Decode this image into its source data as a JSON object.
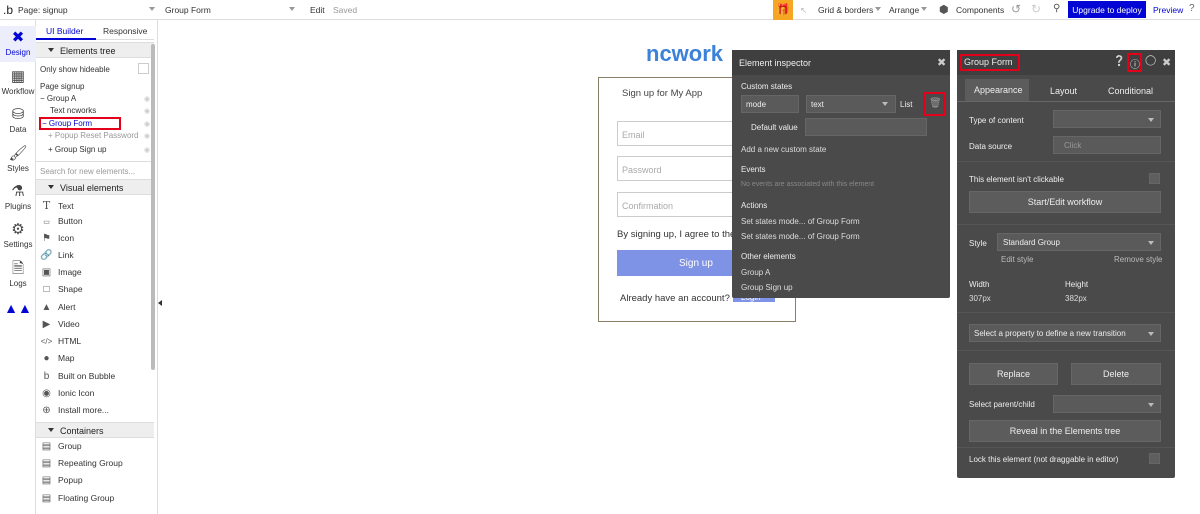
{
  "topbar": {
    "page_label": "Page: signup",
    "element_select": "Group Form",
    "edit": "Edit",
    "saved": "Saved",
    "grid": "Grid & borders",
    "arrange": "Arrange",
    "components": "Components",
    "upgrade": "Upgrade to deploy",
    "preview": "Preview"
  },
  "rail": [
    "Design",
    "Workflow",
    "Data",
    "Styles",
    "Plugins",
    "Settings",
    "Logs"
  ],
  "lpanel": {
    "tab_builder": "UI Builder",
    "tab_responsive": "Responsive",
    "elements_tree": "Elements tree",
    "only_hideable": "Only show hideable",
    "tree": [
      "Page signup",
      "Group A",
      "Text ncworks",
      "Group Form",
      "Popup Reset Password",
      "Group Sign up"
    ],
    "search_placeholder": "Search for new elements...",
    "visual_elements": "Visual elements",
    "visual_items": [
      "Text",
      "Button",
      "Icon",
      "Link",
      "Image",
      "Shape",
      "Alert",
      "Video",
      "HTML",
      "Map",
      "Built on Bubble",
      "Ionic Icon",
      "Install more..."
    ],
    "containers": "Containers",
    "container_items": [
      "Group",
      "Repeating Group",
      "Popup",
      "Floating Group"
    ]
  },
  "canvas": {
    "title": "ncwork",
    "signup_title": "Sign up for My App",
    "email": "Email",
    "password": "Password",
    "confirmation": "Confirmation",
    "agree": "By signing up, I agree to the",
    "signup_btn": "Sign up",
    "already": "Already have an account?",
    "login": "Login"
  },
  "inspector": {
    "title": "Element inspector",
    "custom_states": "Custom states",
    "state_name": "mode",
    "state_type": "text",
    "list": "List",
    "default_value": "Default value",
    "add_state": "Add a new custom state",
    "events": "Events",
    "no_events": "No events are associated with this element",
    "actions": "Actions",
    "action1": "Set states mode... of Group Form",
    "action2": "Set states mode... of Group Form",
    "other": "Other elements",
    "other1": "Group A",
    "other2": "Group Sign up"
  },
  "props": {
    "title": "Group Form",
    "tabs": [
      "Appearance",
      "Layout",
      "Conditional"
    ],
    "type_of_content": "Type of content",
    "data_source": "Data source",
    "click": "Click",
    "not_clickable": "This element isn't clickable",
    "workflow_btn": "Start/Edit workflow",
    "style": "Style",
    "style_value": "Standard Group",
    "edit_style": "Edit style",
    "remove_style": "Remove style",
    "width_label": "Width",
    "width_value": "307px",
    "height_label": "Height",
    "height_value": "382px",
    "transition": "Select a property to define a new transition",
    "replace": "Replace",
    "delete": "Delete",
    "select_parent": "Select parent/child",
    "reveal": "Reveal in the Elements tree",
    "lock": "Lock this element (not draggable in editor)"
  },
  "colors": {
    "accent": "#0205d3",
    "blue_title": "#3b82d8",
    "red_highlight": "#e3001b",
    "dark_panel": "#4a4a4a"
  }
}
